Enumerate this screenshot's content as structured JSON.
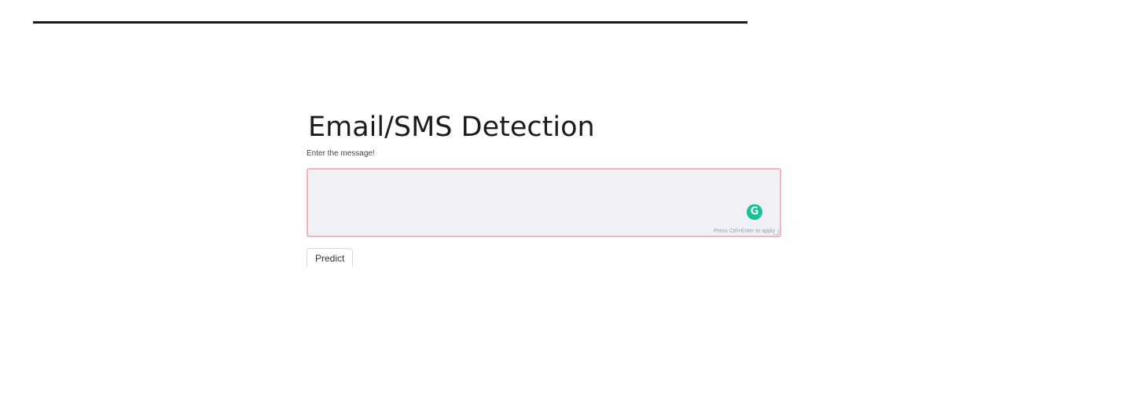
{
  "app": {
    "title": "Email/SMS Detection",
    "input_label": "Enter the message!",
    "message_value": "",
    "hint": "Press Ctrl+Enter to apply",
    "predict_label": "Predict"
  },
  "icons": {
    "grammarly": "grammarly-icon",
    "grammarly_glyph": "G"
  },
  "colors": {
    "accent_border": "#f2b5bd",
    "textarea_bg": "#f0f1f4",
    "grammarly": "#15c39a"
  }
}
